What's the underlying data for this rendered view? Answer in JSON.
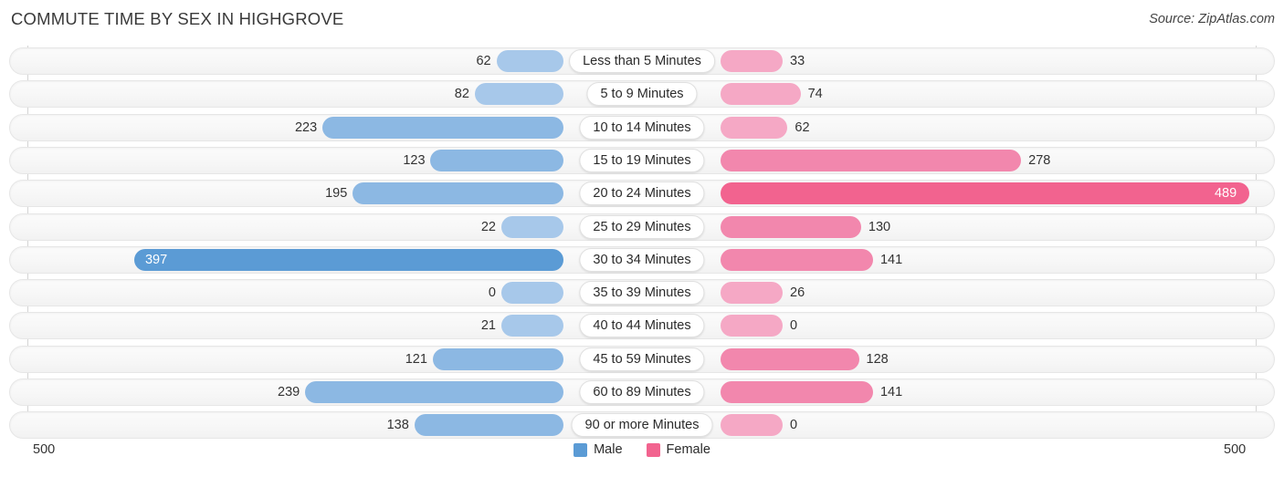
{
  "header": {
    "title": "COMMUTE TIME BY SEX IN HIGHGROVE",
    "source": "Source: ZipAtlas.com"
  },
  "axis": {
    "left_tick": "500",
    "right_tick": "500",
    "max": 500
  },
  "legend": {
    "items": [
      {
        "label": "Male",
        "color": "#5b9bd5"
      },
      {
        "label": "Female",
        "color": "#f2638f"
      }
    ]
  },
  "colors": {
    "male_light": "#a7c8ea",
    "male_mid": "#8cb8e3",
    "male_strong": "#5b9bd5",
    "female_light": "#f5a8c5",
    "female_mid": "#f287ad",
    "female_strong": "#f2638f",
    "track": "#f6f6f6",
    "axis": "#d4d4d4"
  },
  "chart_data": {
    "type": "bar",
    "orientation": "horizontal-diverging",
    "title": "COMMUTE TIME BY SEX IN HIGHGROVE",
    "xlabel": "",
    "ylabel": "",
    "xlim": [
      0,
      500
    ],
    "grid": false,
    "legend_position": "bottom-center",
    "categories": [
      "Less than 5 Minutes",
      "5 to 9 Minutes",
      "10 to 14 Minutes",
      "15 to 19 Minutes",
      "20 to 24 Minutes",
      "25 to 29 Minutes",
      "30 to 34 Minutes",
      "35 to 39 Minutes",
      "40 to 44 Minutes",
      "45 to 59 Minutes",
      "60 to 89 Minutes",
      "90 or more Minutes"
    ],
    "series": [
      {
        "name": "Male",
        "values": [
          62,
          82,
          223,
          123,
          195,
          22,
          397,
          0,
          21,
          121,
          239,
          138
        ]
      },
      {
        "name": "Female",
        "values": [
          33,
          74,
          62,
          278,
          489,
          130,
          141,
          26,
          0,
          128,
          141,
          0
        ]
      }
    ]
  },
  "rows": [
    {
      "category": "Less than 5 Minutes",
      "male": "62",
      "female": "33",
      "male_value": 62,
      "female_value": 33
    },
    {
      "category": "5 to 9 Minutes",
      "male": "82",
      "female": "74",
      "male_value": 82,
      "female_value": 74
    },
    {
      "category": "10 to 14 Minutes",
      "male": "223",
      "female": "62",
      "male_value": 223,
      "female_value": 62
    },
    {
      "category": "15 to 19 Minutes",
      "male": "123",
      "female": "278",
      "male_value": 123,
      "female_value": 278
    },
    {
      "category": "20 to 24 Minutes",
      "male": "195",
      "female": "489",
      "male_value": 195,
      "female_value": 489
    },
    {
      "category": "25 to 29 Minutes",
      "male": "22",
      "female": "130",
      "male_value": 22,
      "female_value": 130
    },
    {
      "category": "30 to 34 Minutes",
      "male": "397",
      "female": "141",
      "male_value": 397,
      "female_value": 141
    },
    {
      "category": "35 to 39 Minutes",
      "male": "0",
      "female": "26",
      "male_value": 0,
      "female_value": 26
    },
    {
      "category": "40 to 44 Minutes",
      "male": "21",
      "female": "0",
      "male_value": 21,
      "female_value": 0
    },
    {
      "category": "45 to 59 Minutes",
      "male": "121",
      "female": "128",
      "male_value": 121,
      "female_value": 128
    },
    {
      "category": "60 to 89 Minutes",
      "male": "239",
      "female": "141",
      "male_value": 239,
      "female_value": 141
    },
    {
      "category": "90 or more Minutes",
      "male": "138",
      "female": "0",
      "male_value": 138,
      "female_value": 0
    }
  ]
}
